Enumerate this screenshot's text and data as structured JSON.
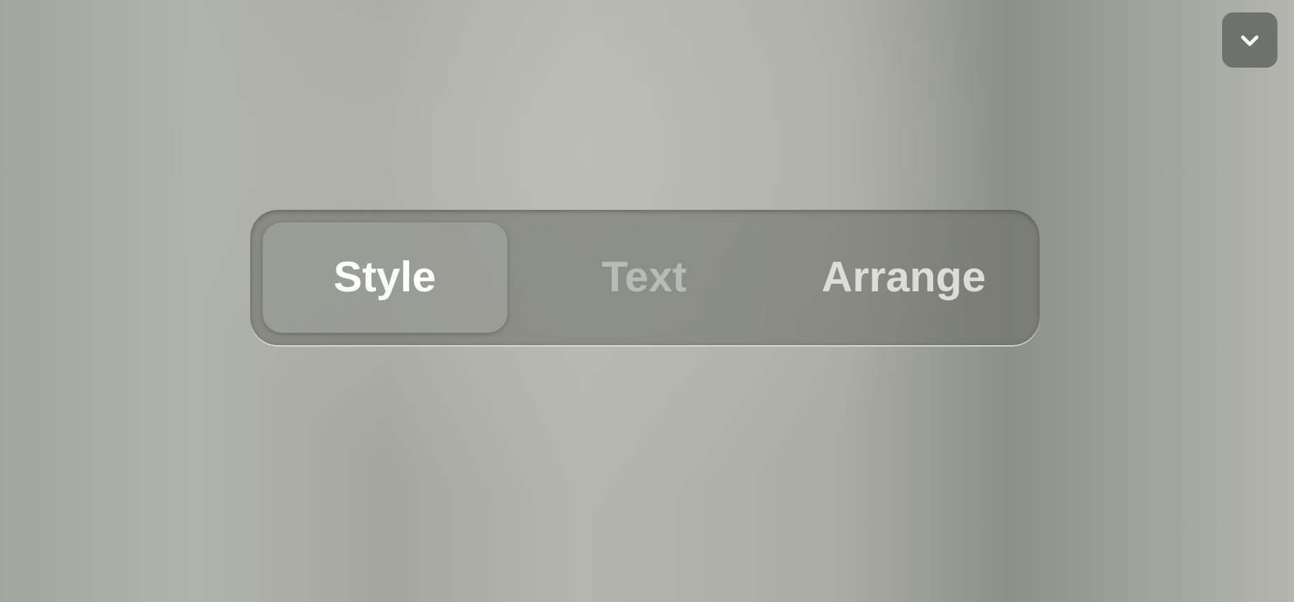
{
  "menu_button": {
    "kind": "chevron"
  },
  "tabs": [
    {
      "label": "Style",
      "selected": true,
      "hovered": false
    },
    {
      "label": "Text",
      "selected": false,
      "hovered": true
    },
    {
      "label": "Arrange",
      "selected": false,
      "hovered": false
    }
  ]
}
